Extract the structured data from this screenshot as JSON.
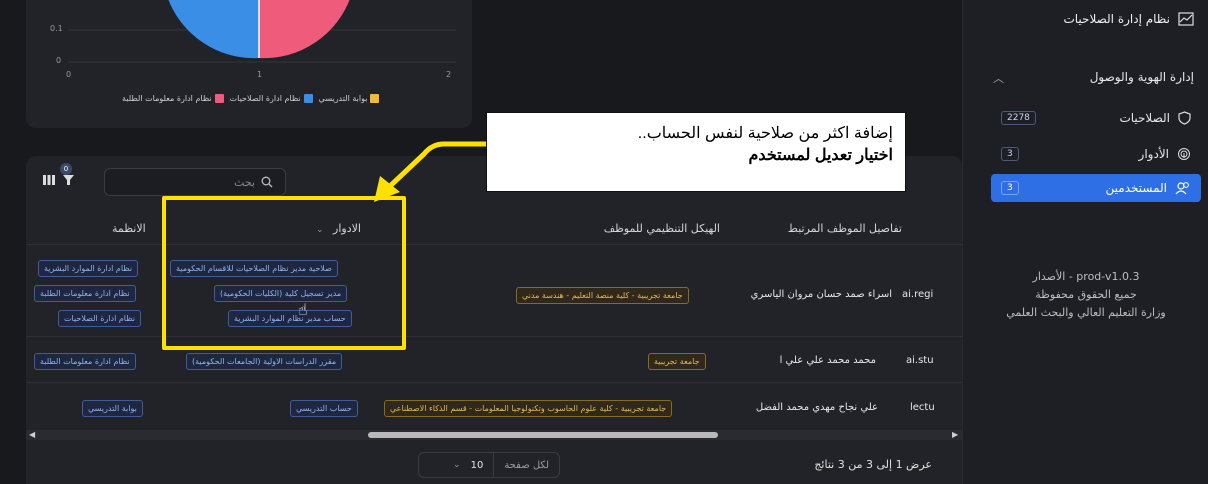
{
  "sidebar": {
    "title": "نظام إدارة الصلاحيات",
    "section": "إدارة الهوية والوصول",
    "items": [
      {
        "label": "الصلاحيات",
        "count": "2278",
        "icon": "shield-icon"
      },
      {
        "label": "الأدوار",
        "count": "3",
        "icon": "fingerprint-icon"
      },
      {
        "label": "المستخدمين",
        "count": "3",
        "icon": "users-icon"
      }
    ],
    "footer": {
      "version": "الأصدار - prod-v1.0.3",
      "rights": "جميع الحقوق محفوظة",
      "org": "وزارة التعليم العالي والبحث العلمي"
    }
  },
  "chart": {
    "y_ticks": [
      "0.1",
      "0"
    ],
    "x_ticks": [
      "0",
      "1",
      "2"
    ]
  },
  "chart_data": {
    "type": "pie",
    "x_ticks": [
      0,
      1,
      2
    ],
    "y_ticks": [
      0,
      0.1
    ],
    "legend": [
      "بوابة التدريسي",
      "نظام ادارة الصلاحيات",
      "نظام ادارة معلومات الطلبة"
    ],
    "colors": {
      "بوابة التدريسي": "#f2b93b",
      "نظام ادارة الصلاحيات": "#3b8ee6",
      "نظام ادارة معلومات الطلبة": "#ef5b7a"
    }
  },
  "table": {
    "search_placeholder": "بحث",
    "filter_count": "0",
    "headers": {
      "employee": "تفاصيل الموظف المرتبط",
      "org": "الهيكل التنظيمي للموظف",
      "roles": "الادوار",
      "systems": "الانظمة"
    },
    "rows": [
      {
        "user": "ai.regi",
        "employee": "اسراء صمد حسان مروان الياسري",
        "org": "جامعة تجريبية - كلية منصة التعليم - هندسة مدني",
        "roles": [
          "صلاحية مدير نظام الصلاحيات للاقسام الحكومية",
          "مدير تسجيل كلية (الكليات الحكومية)",
          "حساب مدير نظام الموارد البشرية"
        ],
        "systems": [
          "نظام ادارة الموارد البشرية",
          "نظام ادارة معلومات الطلبة",
          "نظام ادارة الصلاحيات"
        ]
      },
      {
        "user": "ai.stu",
        "employee": "محمد محمد علي علي ا",
        "org": "جامعة تجريبية",
        "roles": [
          "مقرر الدراسات الاولية (الجامعات الحكومية)"
        ],
        "systems": [
          "نظام ادارة معلومات الطلبة"
        ]
      },
      {
        "user": "lectu",
        "employee": "علي نجاح مهدي محمد الفضل",
        "org": "جامعة تجريبية - كلية علوم الحاسوب وتكنولوجيا المعلومات - قسم الذكاء الاصطناعي",
        "roles": [
          "حساب التدريسي"
        ],
        "systems": [
          "بوابة التدريسي"
        ]
      }
    ],
    "pager": {
      "label": "لكل صفحة",
      "value": "10"
    },
    "results": "عرض 1 إلى 3 من 3 نتائج"
  },
  "annotation": {
    "line1": "إضافة اكثر من صلاحية لنفس الحساب..",
    "line2": "اختيار تعديل لمستخدم"
  },
  "colors": {
    "accent": "#2f6fe6",
    "highlight": "#ffe100"
  }
}
